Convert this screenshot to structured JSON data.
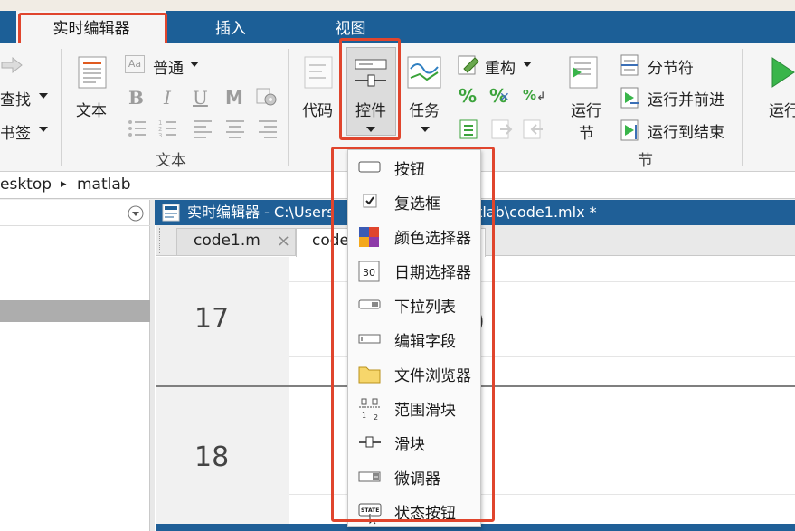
{
  "tabs": [
    {
      "label": "实时编辑器",
      "active": true
    },
    {
      "label": "插入",
      "active": false
    },
    {
      "label": "视图",
      "active": false
    }
  ],
  "ribbon": {
    "navigate": {
      "find": "查找",
      "bookmark": "书签"
    },
    "text_section": {
      "text_button": "文本",
      "style_value": "普通",
      "bold": "B",
      "italic": "I",
      "underline": "U",
      "mono": "M",
      "label": "文本"
    },
    "code_button": "代码",
    "controls_button": "控件",
    "task_button": "任务",
    "refactor_label": "重构",
    "run_section": {
      "run_section_button": "运行节",
      "run_section_line1": "运行",
      "run_section_line2": "节",
      "section_break": "分节符",
      "run_and_advance": "运行并前进",
      "run_to_end": "运行到结束",
      "label": "节"
    },
    "run_button": "运行"
  },
  "address": {
    "parts": [
      "esktop",
      "matlab"
    ]
  },
  "editor": {
    "title": "实时编辑器 - C:\\Users",
    "title_tail": "matlab\\code1.mlx *",
    "tabs": [
      {
        "label": "code1.m",
        "close": "×"
      },
      {
        "label": "code"
      }
    ],
    "line_numbers": [
      "17",
      "18"
    ],
    "partial_paren": ")"
  },
  "controls_menu": {
    "items": [
      {
        "label": "按钮",
        "icon": "button-icon"
      },
      {
        "label": "复选框",
        "icon": "checkbox-icon"
      },
      {
        "label": "颜色选择器",
        "icon": "color-picker-icon"
      },
      {
        "label": "日期选择器",
        "icon": "date-picker-icon",
        "icon_text": "30"
      },
      {
        "label": "下拉列表",
        "icon": "dropdown-icon"
      },
      {
        "label": "编辑字段",
        "icon": "edit-field-icon"
      },
      {
        "label": "文件浏览器",
        "icon": "folder-icon"
      },
      {
        "label": "范围滑块",
        "icon": "range-slider-icon"
      },
      {
        "label": "滑块",
        "icon": "slider-icon"
      },
      {
        "label": "微调器",
        "icon": "spinner-icon"
      },
      {
        "label": "状态按钮",
        "icon": "state-button-icon",
        "icon_text": "STATE"
      }
    ]
  },
  "colors": {
    "tab_bar": "#1c5f97",
    "highlight": "#e0452d",
    "run_green": "#39b54a"
  }
}
